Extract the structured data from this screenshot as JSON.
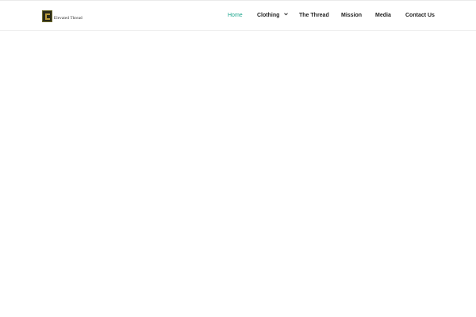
{
  "logo": {
    "text": "Elevated Thread"
  },
  "nav": {
    "items": [
      {
        "label": "Home"
      },
      {
        "label": "Clothing"
      },
      {
        "label": "The Thread"
      },
      {
        "label": "Mission"
      },
      {
        "label": "Media"
      },
      {
        "label": "Contact Us"
      }
    ]
  },
  "colors": {
    "accent": "#1aa58c",
    "text": "#222222",
    "background": "#ffffff"
  },
  "icons": {
    "clothing_dropdown": "chevron-down-icon"
  }
}
